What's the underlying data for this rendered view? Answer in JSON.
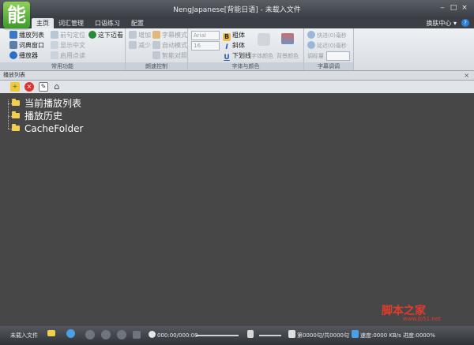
{
  "window": {
    "logo": "能",
    "title": "NengJapanese[背能日语] - 未载入文件",
    "minimize": "–",
    "maximize": "□",
    "close": "×"
  },
  "tabs": [
    {
      "label": "主页",
      "active": true
    },
    {
      "label": "词汇管理",
      "active": false
    },
    {
      "label": "口语练习",
      "active": false
    },
    {
      "label": "配置",
      "active": false
    }
  ],
  "skin_center": "换肤中心 ▾",
  "help": "?",
  "ribbon": {
    "groups": {
      "common": "常用功能",
      "speed": "朗速控制",
      "font": "字体与颜色",
      "subtitle": "字幕调调"
    },
    "common": {
      "playlist": "播放列表",
      "prev_sentence": "前句定位",
      "study": "这下迈看",
      "dict": "词典窗口",
      "show_chinese": "显示中文",
      "player": "播放器",
      "enable_points": "启用点读"
    },
    "speed": {
      "increase": "增加",
      "decrease": "减少",
      "subtitle_mode": "字幕模式",
      "auto_mode": "自动模式",
      "sentence_compare": "智能对照"
    },
    "font": {
      "font_name": "Arial",
      "font_size": "16",
      "bold": "粗体",
      "italic": "斜体",
      "underline": "下划线",
      "font_color": "字体颜色",
      "bg_color": "背景颜色"
    },
    "subtitle": {
      "forward": "快进(0)毫秒",
      "rewind": "延迟(0)毫秒",
      "volume": "调标量"
    }
  },
  "panel": {
    "title": "播放列表",
    "close": "×"
  },
  "tree": [
    {
      "label": "当前播放列表"
    },
    {
      "label": "播放历史"
    },
    {
      "label": "CacheFolder"
    }
  ],
  "watermark": {
    "text": "脚本之家",
    "url": "www.jb51.net"
  },
  "status": {
    "file": "未载入文件",
    "time": "000:00/000:00",
    "sentence": "第0000句/共0000句",
    "speed": "速度:0000 KB/s 进度:0000%"
  }
}
